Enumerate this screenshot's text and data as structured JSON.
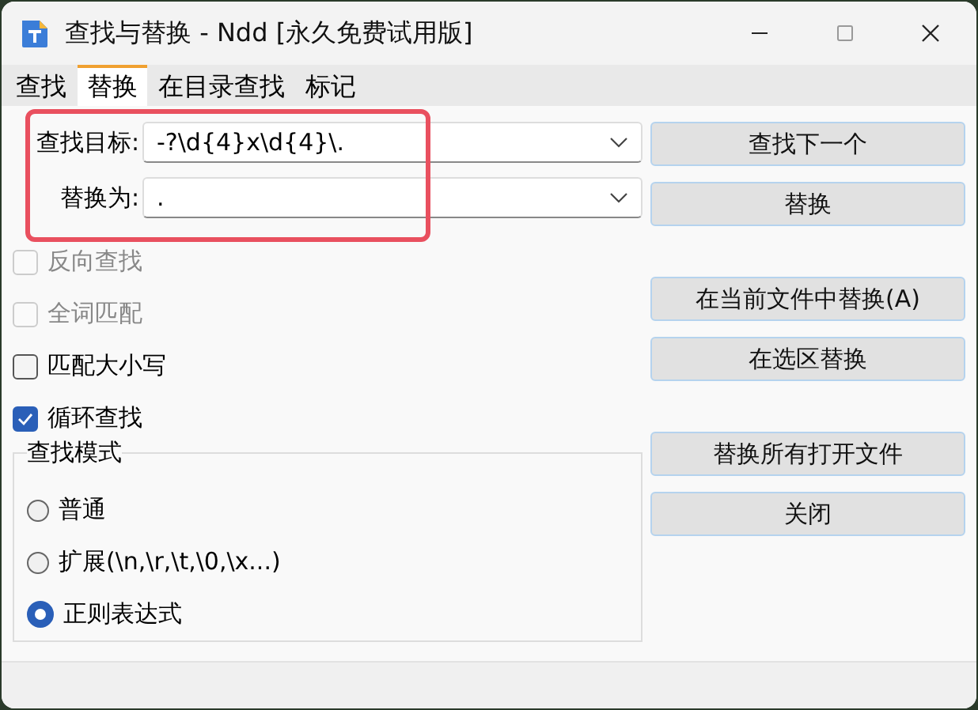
{
  "window": {
    "title": "查找与替换 - Ndd [永久免费试用版]"
  },
  "tabs": [
    {
      "label": "查找",
      "selected": false
    },
    {
      "label": "替换",
      "selected": true
    },
    {
      "label": "在目录查找",
      "selected": false
    },
    {
      "label": "标记",
      "selected": false
    }
  ],
  "fields": [
    {
      "label": "查找目标:",
      "value": "-?\\d{4}x\\d{4}\\."
    },
    {
      "label": "替换为:",
      "value": "."
    }
  ],
  "highlight": {
    "kind": "rectangle"
  },
  "options": [
    {
      "label": "反向查找",
      "checked": false,
      "disabled": true
    },
    {
      "label": "全词匹配",
      "checked": false,
      "disabled": true
    },
    {
      "label": "匹配大小写",
      "checked": false,
      "disabled": false
    },
    {
      "label": "循环查找",
      "checked": true,
      "disabled": false
    }
  ],
  "search_mode": {
    "title": "查找模式",
    "options": [
      {
        "label": "普通",
        "selected": false
      },
      {
        "label": "扩展(\\n,\\r,\\t,\\0,\\x...)",
        "selected": false
      },
      {
        "label": "正则表达式",
        "selected": true
      }
    ]
  },
  "button_groups": [
    [
      "查找下一个",
      "替换"
    ],
    [
      "在当前文件中替换(A)",
      "在选区替换"
    ],
    [
      "替换所有打开文件",
      "关闭"
    ]
  ]
}
